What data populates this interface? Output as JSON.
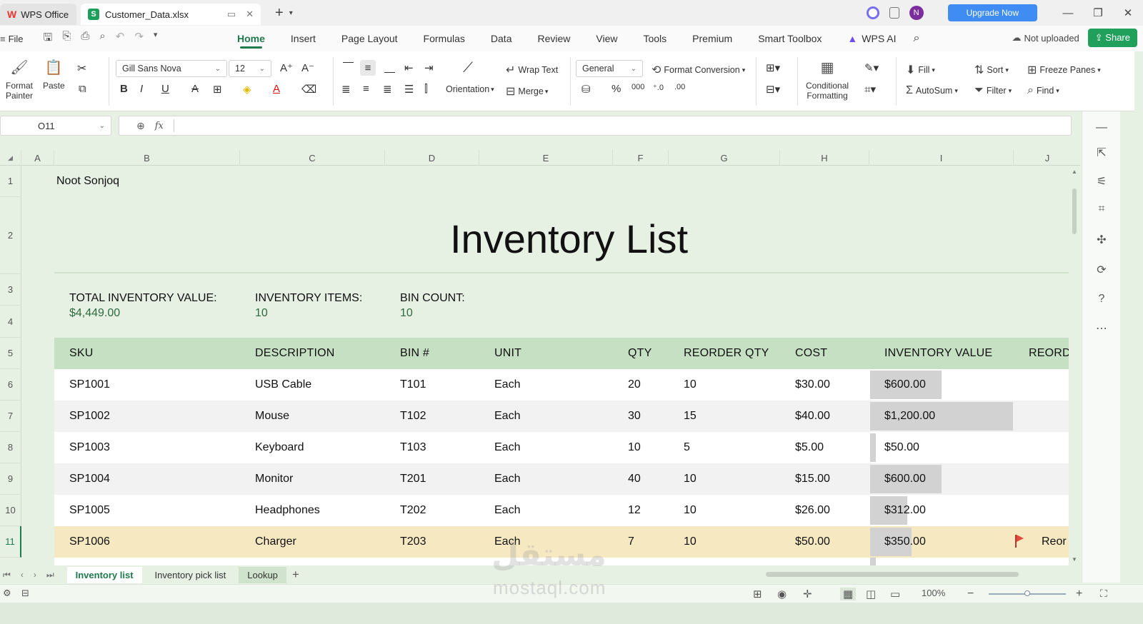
{
  "titlebar": {
    "app_tab": "WPS Office",
    "file_tab": "Customer_Data.xlsx",
    "avatar_letter": "N",
    "upgrade_label": "Upgrade Now"
  },
  "menubar": {
    "file_label": "File",
    "items": [
      "Home",
      "Insert",
      "Page Layout",
      "Formulas",
      "Data",
      "Review",
      "View",
      "Tools",
      "Premium",
      "Smart Toolbox",
      "WPS AI"
    ],
    "active": "Home",
    "not_uploaded": "Not uploaded",
    "share": "Share"
  },
  "ribbon": {
    "format_painter_1": "Format",
    "format_painter_2": "Painter",
    "paste": "Paste",
    "font_name": "Gill Sans Nova",
    "font_size": "12",
    "wrap_text": "Wrap Text",
    "merge": "Merge",
    "orientation": "Orientation",
    "number_format": "General",
    "format_conversion": "Format Conversion",
    "conditional_1": "Conditional",
    "conditional_2": "Formatting",
    "fill": "Fill",
    "sort": "Sort",
    "freeze_panes": "Freeze Panes",
    "autosum": "AutoSum",
    "filter": "Filter",
    "find": "Find"
  },
  "formula_bar": {
    "name_box": "O11",
    "fx": "fx",
    "formula": ""
  },
  "columns": [
    "A",
    "B",
    "C",
    "D",
    "E",
    "F",
    "G",
    "H",
    "I",
    "J"
  ],
  "rows": [
    "1",
    "2",
    "3",
    "4",
    "5",
    "6",
    "7",
    "8",
    "9",
    "10",
    "11"
  ],
  "sheet": {
    "company": "Noot Sonjoq",
    "title": "Inventory List",
    "stats": [
      {
        "label": "TOTAL INVENTORY VALUE:",
        "value": "$4,449.00"
      },
      {
        "label": "INVENTORY ITEMS:",
        "value": "10"
      },
      {
        "label": "BIN COUNT:",
        "value": "10"
      }
    ],
    "headers": [
      "SKU",
      "DESCRIPTION",
      "BIN #",
      "UNIT",
      "QTY",
      "REORDER QTY",
      "COST",
      "INVENTORY VALUE",
      "REORD"
    ],
    "rows": [
      {
        "sku": "SP1001",
        "desc": "USB Cable",
        "bin": "T101",
        "unit": "Each",
        "qty": "20",
        "reorder": "10",
        "cost": "$30.00",
        "value": "$600.00",
        "bar": 600,
        "flag": "",
        "reord": ""
      },
      {
        "sku": "SP1002",
        "desc": "Mouse",
        "bin": "T102",
        "unit": "Each",
        "qty": "30",
        "reorder": "15",
        "cost": "$40.00",
        "value": "$1,200.00",
        "bar": 1200,
        "flag": "",
        "reord": ""
      },
      {
        "sku": "SP1003",
        "desc": "Keyboard",
        "bin": "T103",
        "unit": "Each",
        "qty": "10",
        "reorder": "5",
        "cost": "$5.00",
        "value": "$50.00",
        "bar": 50,
        "flag": "",
        "reord": ""
      },
      {
        "sku": "SP1004",
        "desc": "Monitor",
        "bin": "T201",
        "unit": "Each",
        "qty": "40",
        "reorder": "10",
        "cost": "$15.00",
        "value": "$600.00",
        "bar": 600,
        "flag": "",
        "reord": ""
      },
      {
        "sku": "SP1005",
        "desc": "Headphones",
        "bin": "T202",
        "unit": "Each",
        "qty": "12",
        "reorder": "10",
        "cost": "$26.00",
        "value": "$312.00",
        "bar": 312,
        "flag": "",
        "reord": ""
      },
      {
        "sku": "SP1006",
        "desc": "Charger",
        "bin": "T203",
        "unit": "Each",
        "qty": "7",
        "reorder": "10",
        "cost": "$50.00",
        "value": "$350.00",
        "bar": 350,
        "flag": "flag-icon",
        "reord": "Reor"
      }
    ],
    "bar_max": 1200
  },
  "sheet_tabs": [
    "Inventory list",
    "Inventory pick list",
    "Lookup"
  ],
  "active_sheet": "Inventory list",
  "status": {
    "zoom": "100%"
  },
  "watermark": {
    "arabic": "مستقل",
    "latin": "mostaql.com"
  },
  "colors": {
    "accent": "#1f7a4d",
    "header_fill": "#c6e0c3",
    "highlight_row": "#f6e9c2",
    "background": "#e6f0e3"
  }
}
